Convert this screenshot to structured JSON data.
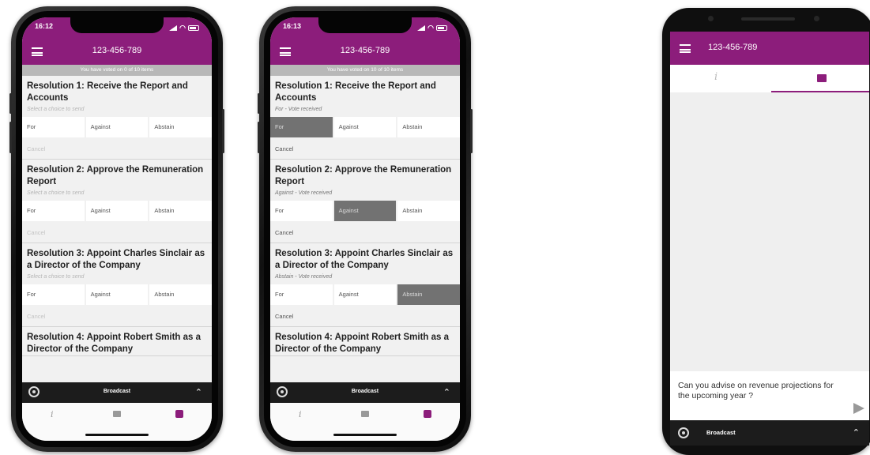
{
  "meeting_id": "123-456-789",
  "broadcast_label": "Broadcast",
  "info_glyph": "i",
  "phones": [
    {
      "time": "16:12",
      "vote_status": "You have voted on 0 of 10 items",
      "resolutions": [
        {
          "title": "Resolution 1: Receive the Report and Accounts",
          "status": "Select a choice to send",
          "choices": [
            "For",
            "Against",
            "Abstain"
          ],
          "selected": null,
          "cancel": "Cancel"
        },
        {
          "title": "Resolution 2: Approve the Remuneration Report",
          "status": "Select a choice to send",
          "choices": [
            "For",
            "Against",
            "Abstain"
          ],
          "selected": null,
          "cancel": "Cancel"
        },
        {
          "title": "Resolution 3: Appoint Charles Sinclair as a Director of the Company",
          "status": "Select a choice to send",
          "choices": [
            "For",
            "Against",
            "Abstain"
          ],
          "selected": null,
          "cancel": "Cancel"
        },
        {
          "title": "Resolution 4: Appoint Robert Smith as a Director of the Company",
          "status": "",
          "choices": [],
          "selected": null,
          "cancel": ""
        }
      ]
    },
    {
      "time": "16:13",
      "vote_status": "You have voted on 10 of 10 items",
      "resolutions": [
        {
          "title": "Resolution 1: Receive the Report and Accounts",
          "status": "For - Vote received",
          "choices": [
            "For",
            "Against",
            "Abstain"
          ],
          "selected": "For",
          "cancel": "Cancel"
        },
        {
          "title": "Resolution 2: Approve the Remuneration Report",
          "status": "Against - Vote received",
          "choices": [
            "For",
            "Against",
            "Abstain"
          ],
          "selected": "Against",
          "cancel": "Cancel"
        },
        {
          "title": "Resolution 3: Appoint Charles Sinclair as a Director of the Company",
          "status": "Abstain - Vote received",
          "choices": [
            "For",
            "Against",
            "Abstain"
          ],
          "selected": "Abstain",
          "cancel": "Cancel"
        },
        {
          "title": "Resolution 4: Appoint Robert Smith as a Director of the Company",
          "status": "",
          "choices": [],
          "selected": null,
          "cancel": ""
        }
      ]
    }
  ],
  "android": {
    "message_text": "Can you advise on revenue projections for the upcoming year ?"
  },
  "colors": {
    "brand": "#8c1d7b",
    "selected_choice": "#727272",
    "broadcast_bar": "#1c1c1c"
  },
  "icons": {
    "menu": "hamburger-menu-icon",
    "broadcast": "broadcast-icon",
    "chevron": "chevron-up-icon",
    "info_tab": "info-icon",
    "chat_tab": "chat-bubble-icon",
    "vote_tab": "vote-icon",
    "send": "send-icon"
  }
}
